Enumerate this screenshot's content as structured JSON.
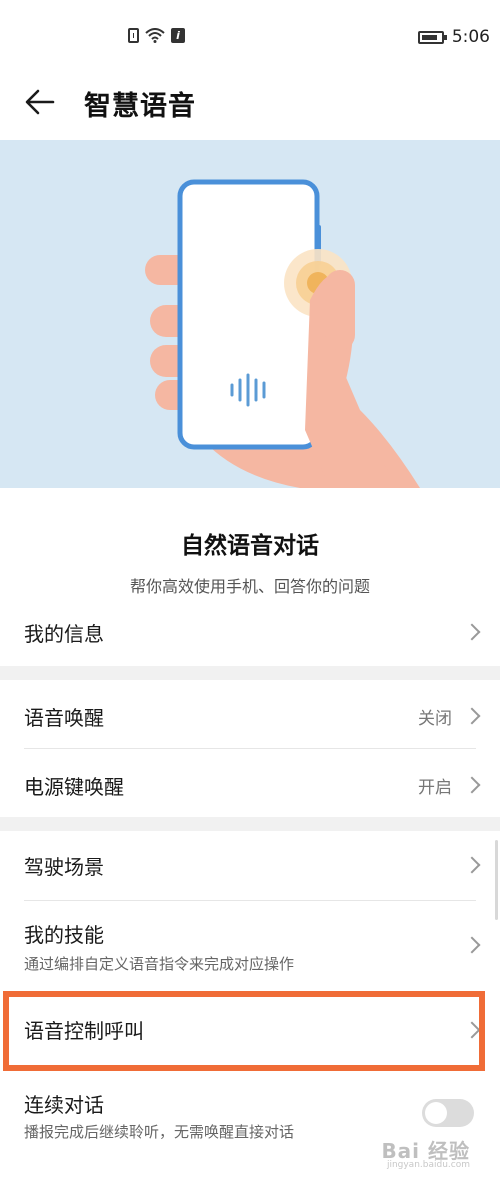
{
  "status_bar": {
    "time": "5:06",
    "battery_level": 0.85,
    "icons": [
      "sim-icon",
      "wifi-icon",
      "info-icon",
      "battery-icon"
    ]
  },
  "header": {
    "title": "智慧语音",
    "back_icon": "back-arrow-icon"
  },
  "intro": {
    "title": "自然语音对话",
    "subtitle": "帮你高效使用手机、回答你的问题"
  },
  "settings": {
    "my_info": {
      "label": "我的信息"
    },
    "voice_wakeup": {
      "label": "语音唤醒",
      "value": "关闭"
    },
    "power_key_wakeup": {
      "label": "电源键唤醒",
      "value": "开启"
    },
    "driving_scene": {
      "label": "驾驶场景"
    },
    "my_skills": {
      "label": "我的技能",
      "description": "通过编排自定义语音指令来完成对应操作"
    },
    "voice_call_control": {
      "label": "语音控制呼叫"
    },
    "continuous_dialog": {
      "label": "连续对话",
      "description": "播报完成后继续聆听，无需唤醒直接对话",
      "enabled": false
    }
  },
  "watermark": {
    "text": "Bai 经验",
    "url": "jingyan.baidu.com"
  },
  "colors": {
    "hero_bg": "#d6e7f3",
    "highlight": "#f06c37",
    "phone_frame": "#4a90d9",
    "hand": "#f5b7a2"
  }
}
